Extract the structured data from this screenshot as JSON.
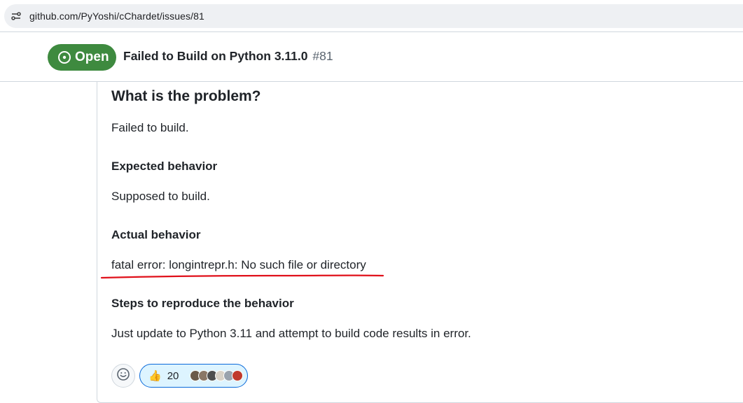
{
  "browser": {
    "url": "github.com/PyYoshi/cChardet/issues/81",
    "site_icon": "site-settings-icon"
  },
  "issue": {
    "state": "Open",
    "state_icon": "issue-opened-icon",
    "title": "Failed to Build on Python 3.11.0",
    "number": "#81"
  },
  "body": {
    "problem_heading": "What is the problem?",
    "problem_text": "Failed to build.",
    "expected_heading": "Expected behavior",
    "expected_text": "Supposed to build.",
    "actual_heading": "Actual behavior",
    "actual_text": "fatal error: longintrepr.h: No such file or directory",
    "steps_heading": "Steps to reproduce the behavior",
    "steps_text": "Just update to Python 3.11 and attempt to build code results in error."
  },
  "reactions": {
    "add_icon": "smiley-icon",
    "items": [
      {
        "emoji_icon": "thumbs-up-icon",
        "emoji": "👍",
        "count": "20"
      }
    ],
    "avatar_colors": [
      "#6b5a4a",
      "#8a7766",
      "#4f4f4f",
      "#d9d2c7",
      "#9aa3ad",
      "#c0392b"
    ]
  },
  "annotation": {
    "underline_color": "#e0101a"
  },
  "colors": {
    "open_green": "#3e8a3f",
    "reaction_bg": "#ddf4ff",
    "reaction_border": "#0969da"
  }
}
